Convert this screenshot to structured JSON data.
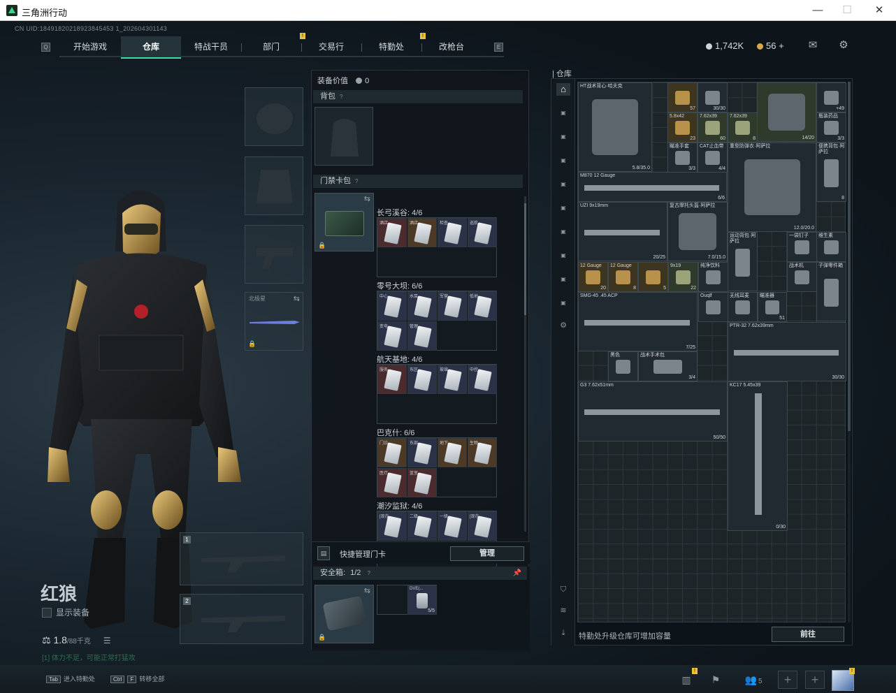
{
  "window": {
    "title": "三角洲行动"
  },
  "uid": "CN UID:18491820218923845453 1_202604301143",
  "nav": {
    "tabs": [
      "开始游戏",
      "仓库",
      "特战干员",
      "部门",
      "交易行",
      "特勤处",
      "改枪台"
    ],
    "active": "仓库",
    "badged": [
      "部门",
      "特勤处"
    ]
  },
  "currency": {
    "main": "1,742K",
    "secondary": "56 +"
  },
  "operator": {
    "name": "红狼",
    "show_equipment": "显示装备",
    "weight": "1.8",
    "weight_unit": "/88千克",
    "warning_prefix": "[1]",
    "warning": "体力不足，可能正常打猛攻"
  },
  "equipment_slots": {
    "weapon_slot": "北极星"
  },
  "weapon_slot_numbers": [
    "1",
    "2"
  ],
  "middle": {
    "equip_value_label": "装备价值",
    "equip_value": "0",
    "backpack_label": "背包",
    "keycard_label": "门禁卡包",
    "maps": [
      {
        "name": "长弓溪谷: 4/6",
        "keys": [
          {
            "label": "酒店",
            "tone": "r"
          },
          {
            "label": "酒店",
            "tone": "o"
          },
          {
            "label": "检查",
            "tone": "b"
          },
          {
            "label": "巡航",
            "tone": "b"
          }
        ]
      },
      {
        "name": "零号大坝: 6/6",
        "keys": [
          {
            "label": "中心",
            "tone": "b"
          },
          {
            "label": "水泵",
            "tone": "b"
          },
          {
            "label": "军营",
            "tone": "b"
          },
          {
            "label": "低地",
            "tone": "b"
          },
          {
            "label": "变电",
            "tone": "b"
          },
          {
            "label": "管理",
            "tone": "b"
          }
        ]
      },
      {
        "name": "航天基地: 4/6",
        "keys": [
          {
            "label": "服务",
            "tone": "r"
          },
          {
            "label": "东区",
            "tone": "b"
          },
          {
            "label": "玻璃",
            "tone": "b"
          },
          {
            "label": "中控",
            "tone": "b"
          }
        ]
      },
      {
        "name": "巴克什: 6/6",
        "keys": [
          {
            "label": "门诊",
            "tone": "o"
          },
          {
            "label": "东部",
            "tone": "b"
          },
          {
            "label": "地下",
            "tone": "o"
          },
          {
            "label": "生物",
            "tone": "o"
          },
          {
            "label": "医疗",
            "tone": "r"
          },
          {
            "label": "蓝室",
            "tone": "r"
          }
        ]
      },
      {
        "name": "潮汐监狱: 4/6",
        "keys": [
          {
            "label": "[现在",
            "tone": "b"
          },
          {
            "label": "二级",
            "tone": "b"
          },
          {
            "label": "一级",
            "tone": "b"
          },
          {
            "label": "[现在",
            "tone": "b"
          }
        ]
      }
    ],
    "quick_manage": "快捷管理门卡",
    "manage_button": "管理",
    "safebox_label": "安全箱:",
    "safebox_count": "1/2",
    "safebox_item": "DVE(...",
    "safebox_item_count": "5/5"
  },
  "warehouse": {
    "title": "仓库",
    "upgrade_hint": "特勤处升级仓库可增加容量",
    "go_button": "前往",
    "items": [
      {
        "name": "HT战术背心·哈夫克",
        "count": "5.8/35.0",
        "tone": "dk"
      },
      {
        "name": "",
        "count": "57",
        "tone": "y"
      },
      {
        "name": "",
        "count": "30/30",
        "tone": "dk"
      },
      {
        "name": "",
        "count": "14/20",
        "tone": "g"
      },
      {
        "name": "",
        "count": "+49",
        "tone": "dk"
      },
      {
        "name": "5.8x42",
        "count": "23",
        "tone": "y"
      },
      {
        "name": "7.62x39",
        "count": "60",
        "tone": "g"
      },
      {
        "name": "7.62x39",
        "count": "8",
        "tone": "g"
      },
      {
        "name": "瞄准手套",
        "count": "3/3",
        "tone": "dk"
      },
      {
        "name": "瓶装药品",
        "count": "3/3",
        "tone": "dk"
      },
      {
        "name": "CAT止血带",
        "count": "4/4",
        "tone": "dk"
      },
      {
        "name": "重型防弹衣·阿萨拉",
        "count": "12.0/20.0",
        "tone": "dk"
      },
      {
        "name": "便携背包·阿萨拉",
        "count": "8",
        "tone": "dk"
      },
      {
        "name": "M870 12 Gauge",
        "count": "6/6",
        "tone": "dk"
      },
      {
        "name": "UZI 9x19mm",
        "count": "20/25",
        "tone": "dk"
      },
      {
        "name": "复古摩托头盔·阿萨拉",
        "count": "7.0/15.0",
        "tone": "dk"
      },
      {
        "name": "运动背包·阿萨拉",
        "count": "",
        "tone": "dk"
      },
      {
        "name": "一袋钉子",
        "count": "",
        "tone": "dk"
      },
      {
        "name": "12 Gauge",
        "count": "20",
        "tone": "y"
      },
      {
        "name": "维生素",
        "count": "",
        "tone": "dk"
      },
      {
        "name": "12 Gauge",
        "count": "8",
        "tone": "y"
      },
      {
        "name": "12 Gauge",
        "count": "20",
        "tone": "y"
      },
      {
        "name": "",
        "count": "5",
        "tone": "y"
      },
      {
        "name": "9x19",
        "count": "22",
        "tone": "g"
      },
      {
        "name": "纯净饮料",
        "count": "",
        "tone": "dk"
      },
      {
        "name": "战术机",
        "count": "",
        "tone": "dk"
      },
      {
        "name": "子弹零件箱",
        "count": "",
        "tone": "dk"
      },
      {
        "name": "SMG-45 .45 ACP",
        "count": "7/25",
        "tone": "dk"
      },
      {
        "name": "Ouqlf",
        "count": "",
        "tone": "dk"
      },
      {
        "name": "无线耳麦",
        "count": "",
        "tone": "dk"
      },
      {
        "name": "瞄准器",
        "count": "51",
        "tone": "dk"
      },
      {
        "name": "PTR-32 7.62x39mm",
        "count": "30/30",
        "tone": "dk"
      },
      {
        "name": "黑色",
        "count": "",
        "tone": "dk"
      },
      {
        "name": "战术手术包",
        "count": "3/4",
        "tone": "dk"
      },
      {
        "name": "G3 7.62x51mm",
        "count": "50/50",
        "tone": "dk"
      },
      {
        "name": "KC17 5.45x39",
        "count": "0/30",
        "tone": "dk"
      }
    ]
  },
  "bottom": {
    "hint1_key": "Tab",
    "hint1": "进入特勤处",
    "hint2_key1": "Ctrl",
    "hint2_key2": "F",
    "hint2": "转移全部",
    "squad_count": "5"
  },
  "colors": {
    "accent": "#3ce0a0",
    "badge": "#e8c33a",
    "coin_main": "#cfd6da",
    "coin_secondary": "#d9a84a"
  }
}
